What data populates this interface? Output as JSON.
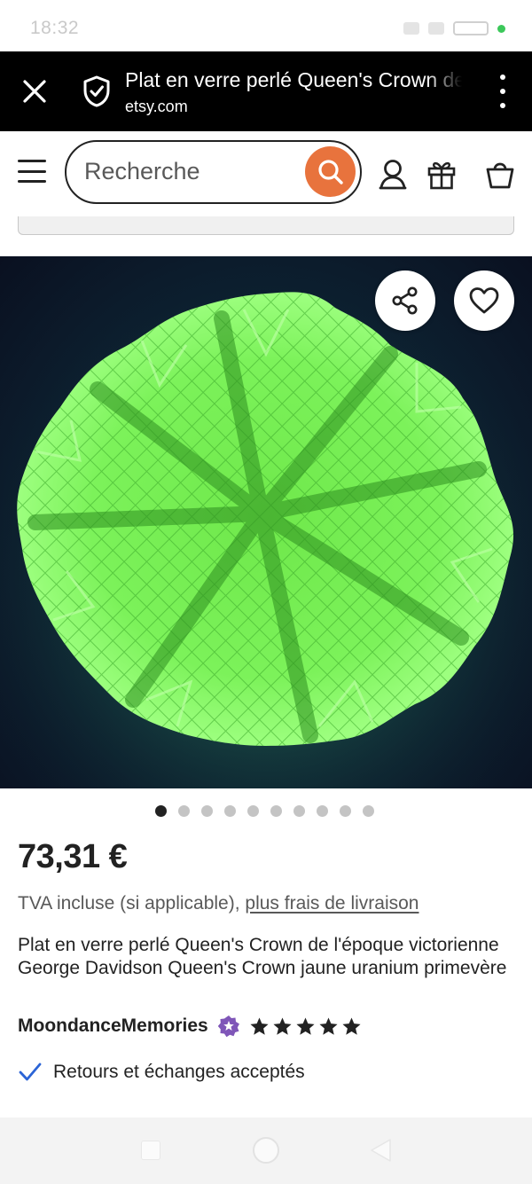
{
  "status_bar": {
    "time": "18:32"
  },
  "browser": {
    "title": "Plat en verre perlé Queen's Crown de l'époque victorienne",
    "url": "etsy.com",
    "close_icon": "close-icon",
    "security_icon": "shield-check-icon",
    "menu_icon": "more-vertical-icon"
  },
  "header": {
    "search_placeholder": "Recherche",
    "icons": [
      "menu-icon",
      "search-icon",
      "account-icon",
      "gift-icon",
      "cart-icon"
    ]
  },
  "gallery": {
    "image_description": "green uranium glass plate glowing under UV light",
    "image_count": 10,
    "active_index": 0,
    "share_icon": "share-icon",
    "favorite_icon": "heart-icon"
  },
  "listing": {
    "price": "73,31 €",
    "tax_prefix": "TVA incluse (si applicable), ",
    "shipping_link": "plus frais de livraison",
    "title": "Plat en verre perlé Queen's Crown de l'époque victorienne George Davidson Queen's Crown jaune uranium primevère",
    "shop_name": "MoondanceMemories",
    "rating": 5,
    "returns": "Retours et échanges acceptés"
  },
  "colors": {
    "accent": "#e8733d",
    "star_seller": "#7f56b8",
    "check": "#2b64d6",
    "glass_green": "#7cf25a"
  }
}
